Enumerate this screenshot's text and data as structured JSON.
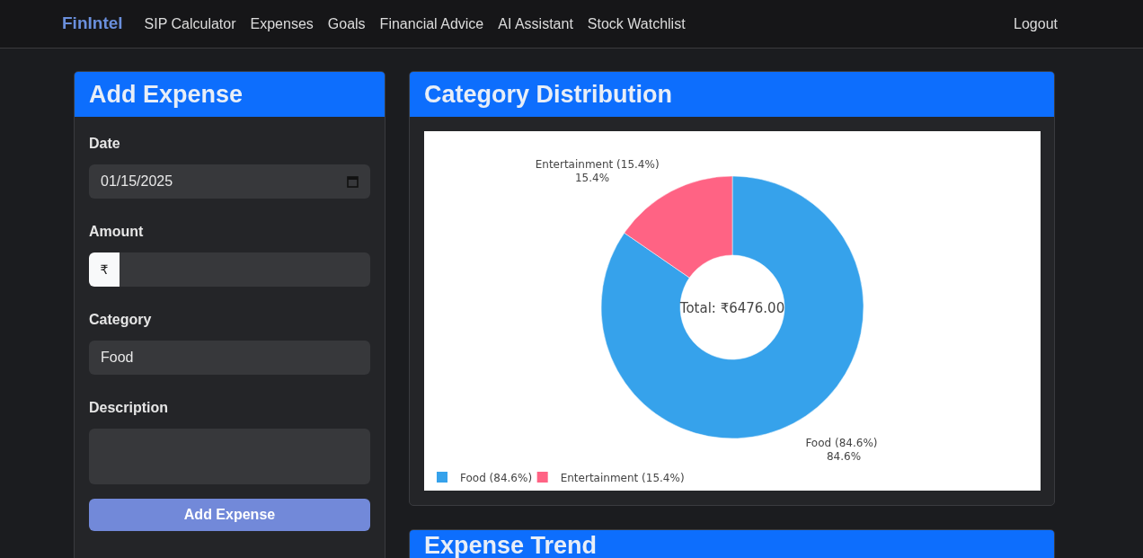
{
  "navbar": {
    "brand": "FinIntel",
    "links": [
      "SIP Calculator",
      "Expenses",
      "Goals",
      "Financial Advice",
      "AI Assistant",
      "Stock Watchlist"
    ],
    "logout": "Logout"
  },
  "add_expense": {
    "title": "Add Expense",
    "fields": [
      {
        "kind": "date",
        "label": "Date",
        "value": "01/15/2025"
      },
      {
        "kind": "amount",
        "label": "Amount",
        "prefix": "₹"
      },
      {
        "kind": "select",
        "label": "Category",
        "value": "Food"
      },
      {
        "kind": "textarea",
        "label": "Description"
      }
    ],
    "submit": "Add Expense"
  },
  "category_distribution": {
    "title": "Category Distribution",
    "chart_data": {
      "type": "donut",
      "categories": [
        "Food (84.6%)",
        "Entertainment (15.4%)"
      ],
      "values": [
        84.6,
        15.4
      ],
      "value_labels": [
        "84.6%",
        "15.4%"
      ],
      "annotations": [
        "Total: ₹6476.00"
      ]
    },
    "legend": [
      {
        "label": "Food (84.6%)",
        "color": "#36a2eb"
      },
      {
        "label": "Entertainment (15.4%)",
        "color": "#ff6384"
      }
    ]
  },
  "expense_trend": {
    "title": "Expense Trend"
  }
}
